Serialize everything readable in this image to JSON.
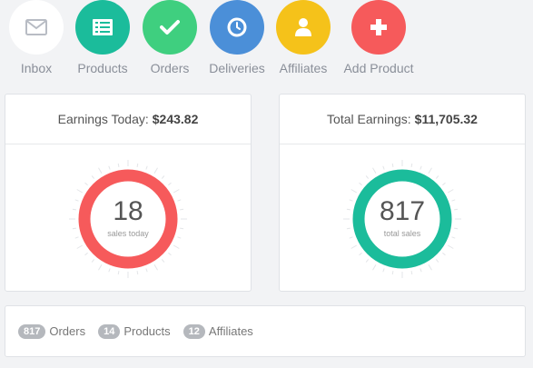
{
  "shortcuts": [
    {
      "label": "Inbox",
      "icon": "envelope-icon",
      "color": "#ffffff"
    },
    {
      "label": "Products",
      "icon": "list-icon",
      "color": "#1bbc9b"
    },
    {
      "label": "Orders",
      "icon": "check-icon",
      "color": "#3fcf7f"
    },
    {
      "label": "Deliveries",
      "icon": "clock-icon",
      "color": "#4b8fd8"
    },
    {
      "label": "Affiliates",
      "icon": "user-icon",
      "color": "#f5c21a"
    },
    {
      "label": "Add Product",
      "icon": "plus-icon",
      "color": "#f65a5b"
    }
  ],
  "today_card": {
    "label": "Earnings Today:",
    "amount": "$243.82",
    "value": "18",
    "caption": "sales today",
    "ring_color": "#f65a5b"
  },
  "total_card": {
    "label": "Total Earnings:",
    "amount": "$11,705.32",
    "value": "817",
    "caption": "total sales",
    "ring_color": "#1bbc9b"
  },
  "summary": {
    "orders_count": "817",
    "orders_label": "Orders",
    "products_count": "14",
    "products_label": "Products",
    "affiliates_count": "12",
    "affiliates_label": "Affiliates"
  }
}
